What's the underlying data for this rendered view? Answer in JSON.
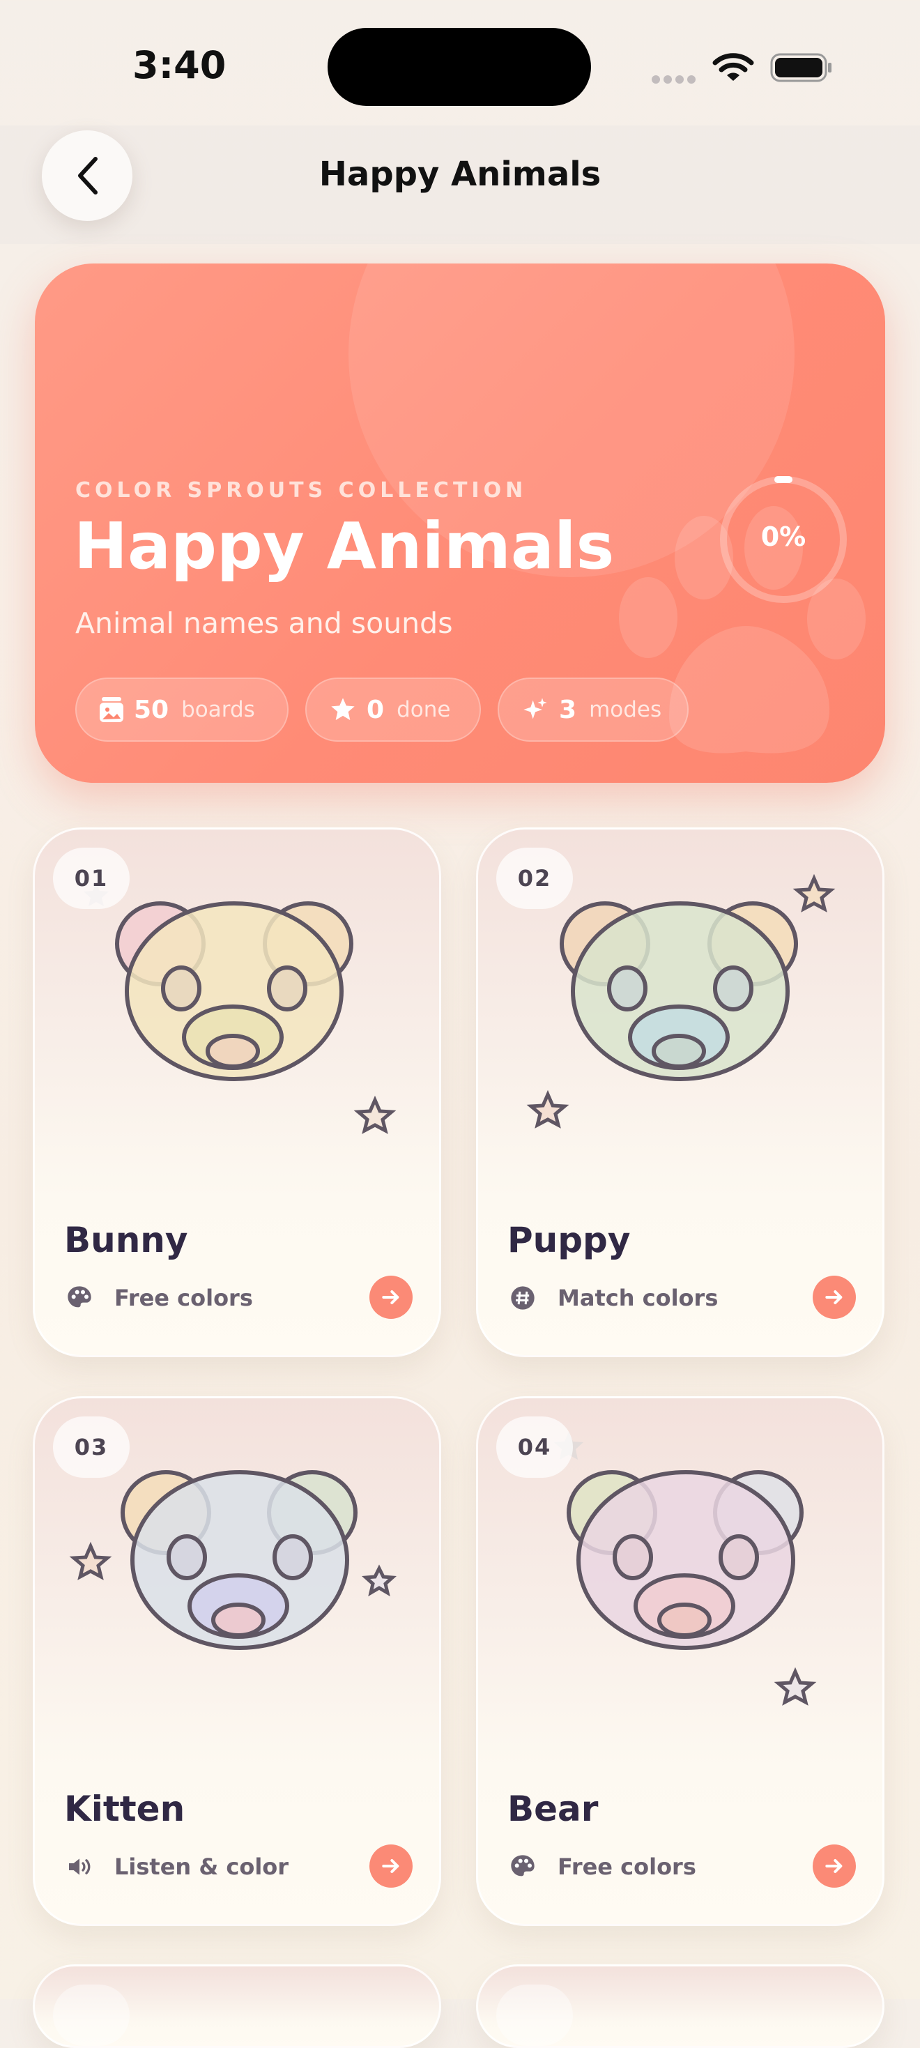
{
  "status_bar": {
    "time": "3:40"
  },
  "nav": {
    "title": "Happy Animals"
  },
  "hero": {
    "kicker": "COLOR SPROUTS COLLECTION",
    "title": "Happy Animals",
    "subtitle": "Animal names and sounds",
    "progress_percent": 0,
    "progress_label": "0%",
    "stats": [
      {
        "icon": "image-stack-icon",
        "value": "50",
        "label": "boards"
      },
      {
        "icon": "star-icon",
        "value": "0",
        "label": "done"
      },
      {
        "icon": "sparkles-icon",
        "value": "3",
        "label": "modes"
      }
    ]
  },
  "cards": [
    {
      "number": "01",
      "name": "Bunny",
      "mode": "Free colors",
      "mode_icon": "palette-icon"
    },
    {
      "number": "02",
      "name": "Puppy",
      "mode": "Match colors",
      "mode_icon": "number-icon"
    },
    {
      "number": "03",
      "name": "Kitten",
      "mode": "Listen & color",
      "mode_icon": "speaker-icon"
    },
    {
      "number": "04",
      "name": "Bear",
      "mode": "Free colors",
      "mode_icon": "palette-icon"
    }
  ],
  "colors": {
    "accent": "#fb8a76",
    "hero": "#ff917d",
    "ink": "#302844"
  }
}
